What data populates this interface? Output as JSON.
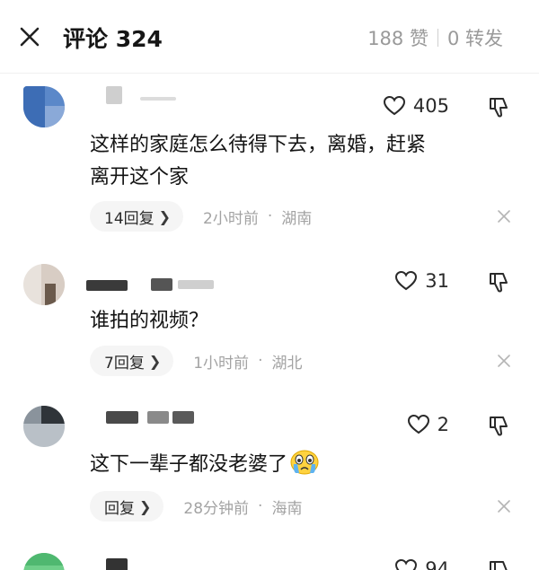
{
  "header": {
    "title": "评论 324",
    "likes": "188 赞",
    "reposts": "0 转发"
  },
  "comments": [
    {
      "likes": "405",
      "text_lines": [
        "这样的家庭怎么待得下去，离婚，赶紧",
        "离开这个家"
      ],
      "reply_label": "14回复",
      "time": "2小时前",
      "region": "湖南"
    },
    {
      "likes": "31",
      "text_lines": [
        "谁拍的视频？"
      ],
      "reply_label": "7回复",
      "time": "1小时前",
      "region": "湖北"
    },
    {
      "likes": "2",
      "text_lines": [
        "这下一辈子都没老婆了"
      ],
      "reply_label": "回复",
      "time": "28分钟前",
      "region": "海南"
    },
    {
      "likes": "94"
    }
  ],
  "icons": {
    "close": "close-icon",
    "like": "heart-outline-icon",
    "dislike": "thumbs-down-icon",
    "dismiss": "x-icon",
    "emoji": "crying-face-emoji"
  }
}
